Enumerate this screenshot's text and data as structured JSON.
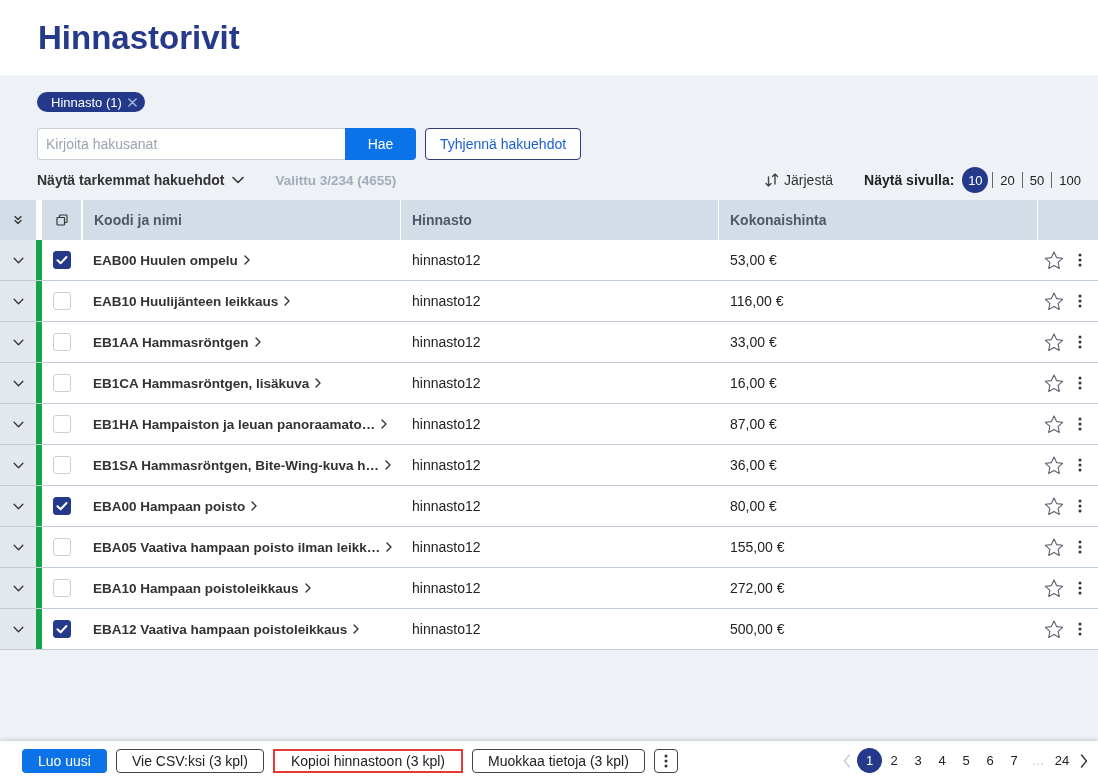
{
  "page": {
    "title": "Hinnastorivit"
  },
  "filters": {
    "chips": [
      {
        "label": "Hinnasto (1)"
      }
    ],
    "search": {
      "placeholder": "Kirjoita hakusanat",
      "button": "Hae"
    },
    "clear_button": "Tyhjennä hakuehdot",
    "advanced_toggle": {
      "label": "Näytä tarkemmat hakuehdot",
      "expanded": false
    },
    "selection_info": "Valittu 3/234 (4655)",
    "sort_button": "Järjestä",
    "page_size": {
      "label": "Näytä sivulla:",
      "options": [
        {
          "label": "10",
          "selected": true
        },
        {
          "label": "20",
          "selected": false
        },
        {
          "label": "50",
          "selected": false
        },
        {
          "label": "100",
          "selected": false
        }
      ]
    }
  },
  "table": {
    "columns": [
      "Koodi ja nimi",
      "Hinnasto",
      "Kokonaishinta"
    ],
    "rows": [
      {
        "checked": true,
        "name": "EAB00 Huulen ompelu",
        "pricelist": "hinnasto12",
        "price": "53,00 €",
        "favorite": false,
        "color": "#16a34a"
      },
      {
        "checked": false,
        "name": "EAB10 Huulijänteen leikkaus",
        "pricelist": "hinnasto12",
        "price": "116,00 €",
        "favorite": false,
        "color": "#16a34a"
      },
      {
        "checked": false,
        "name": "EB1AA Hammasröntgen",
        "pricelist": "hinnasto12",
        "price": "33,00 €",
        "favorite": false,
        "color": "#16a34a"
      },
      {
        "checked": false,
        "name": "EB1CA Hammasröntgen, lisäkuva",
        "pricelist": "hinnasto12",
        "price": "16,00 €",
        "favorite": false,
        "color": "#16a34a"
      },
      {
        "checked": false,
        "name": "EB1HA Hampaiston ja leuan panoraamato…",
        "pricelist": "hinnasto12",
        "price": "87,00 €",
        "favorite": false,
        "color": "#16a34a"
      },
      {
        "checked": false,
        "name": "EB1SA Hammasröntgen, Bite-Wing-kuva h…",
        "pricelist": "hinnasto12",
        "price": "36,00 €",
        "favorite": false,
        "color": "#16a34a"
      },
      {
        "checked": true,
        "name": "EBA00 Hampaan poisto",
        "pricelist": "hinnasto12",
        "price": "80,00 €",
        "favorite": false,
        "color": "#16a34a"
      },
      {
        "checked": false,
        "name": "EBA05 Vaativa hampaan poisto ilman leikk…",
        "pricelist": "hinnasto12",
        "price": "155,00 €",
        "favorite": false,
        "color": "#16a34a"
      },
      {
        "checked": false,
        "name": "EBA10 Hampaan poistoleikkaus",
        "pricelist": "hinnasto12",
        "price": "272,00 €",
        "favorite": false,
        "color": "#16a34a"
      },
      {
        "checked": true,
        "name": "EBA12 Vaativa hampaan poistoleikkaus",
        "pricelist": "hinnasto12",
        "price": "500,00 €",
        "favorite": false,
        "color": "#16a34a"
      }
    ]
  },
  "footer": {
    "buttons": [
      {
        "label": "Luo uusi",
        "kind": "primary",
        "highlighted": false
      },
      {
        "label": "Vie CSV:ksi (3 kpl)",
        "kind": "secondary",
        "highlighted": false
      },
      {
        "label": "Kopioi hinnastoon (3 kpl)",
        "kind": "secondary",
        "highlighted": true
      },
      {
        "label": "Muokkaa tietoja (3 kpl)",
        "kind": "secondary",
        "highlighted": false
      }
    ],
    "pagination": {
      "prev_disabled": true,
      "next_disabled": false,
      "pages": [
        {
          "label": "1",
          "kind": "page",
          "selected": true
        },
        {
          "label": "2",
          "kind": "page",
          "selected": false
        },
        {
          "label": "3",
          "kind": "page",
          "selected": false
        },
        {
          "label": "4",
          "kind": "page",
          "selected": false
        },
        {
          "label": "5",
          "kind": "page",
          "selected": false
        },
        {
          "label": "6",
          "kind": "page",
          "selected": false
        },
        {
          "label": "7",
          "kind": "page",
          "selected": false
        },
        {
          "label": "…",
          "kind": "ellipsis"
        },
        {
          "label": "24",
          "kind": "page",
          "selected": false
        }
      ]
    }
  }
}
